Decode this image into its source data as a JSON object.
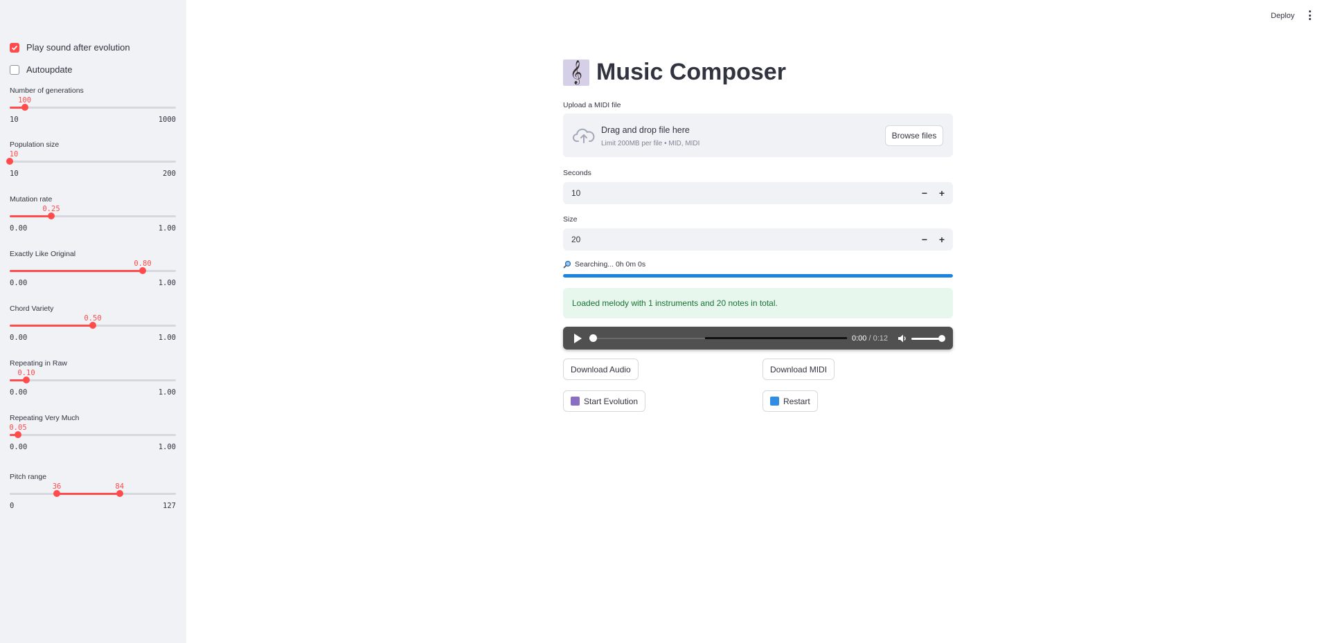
{
  "header": {
    "deploy_label": "Deploy",
    "menu_icon": "kebab-menu-icon"
  },
  "sidebar": {
    "checkboxes": [
      {
        "label": "Play sound after evolution",
        "checked": true
      },
      {
        "label": "Autoupdate",
        "checked": false
      }
    ],
    "sliders": [
      {
        "label": "Number of generations",
        "value": "100",
        "min": "10",
        "max": "1000",
        "fraction": 0.09
      },
      {
        "label": "Population size",
        "value": "10",
        "min": "10",
        "max": "200",
        "fraction": 0.0
      },
      {
        "label": "Mutation rate",
        "value": "0.25",
        "min": "0.00",
        "max": "1.00",
        "fraction": 0.25
      },
      {
        "label": "Exactly Like Original",
        "value": "0.80",
        "min": "0.00",
        "max": "1.00",
        "fraction": 0.8
      },
      {
        "label": "Chord Variety",
        "value": "0.50",
        "min": "0.00",
        "max": "1.00",
        "fraction": 0.5
      },
      {
        "label": "Repeating in Raw",
        "value": "0.10",
        "min": "0.00",
        "max": "1.00",
        "fraction": 0.1
      },
      {
        "label": "Repeating Very Much",
        "value": "0.05",
        "min": "0.00",
        "max": "1.00",
        "fraction": 0.05
      }
    ],
    "pitch_range": {
      "label": "Pitch range",
      "low": "36",
      "high": "84",
      "min": "0",
      "max": "127",
      "low_fraction": 0.2835,
      "high_fraction": 0.6614
    }
  },
  "main": {
    "title": "Music Composer",
    "title_icon": "treble-clef-icon",
    "upload": {
      "label": "Upload a MIDI file",
      "drop_text": "Drag and drop file here",
      "limit_text": "Limit 200MB per file • MID, MIDI",
      "browse_label": "Browse files"
    },
    "seconds": {
      "label": "Seconds",
      "value": "10"
    },
    "size": {
      "label": "Size",
      "value": "20"
    },
    "progress": {
      "text": "Searching... 0h 0m 0s",
      "fraction": 1.0,
      "color": "#1c83e1"
    },
    "alert": {
      "text": "Loaded melody with 1 instruments and 20 notes in total."
    },
    "audio": {
      "current": "0:00",
      "duration": "/ 0:12"
    },
    "buttons": {
      "download_audio": "Download Audio",
      "download_midi": "Download MIDI",
      "start_evolution": "Start Evolution",
      "restart": "Restart"
    }
  },
  "colors": {
    "accent": "#ff4b4b",
    "sidebar_bg": "#f0f2f6",
    "success_bg": "#e8f7ed",
    "success_text": "#177233"
  }
}
